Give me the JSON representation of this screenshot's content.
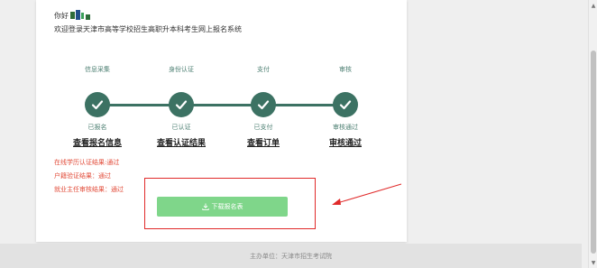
{
  "header": {
    "greeting": "你好",
    "welcome": "欢迎登录天津市高等学校招生高职升本科考生网上报名系统"
  },
  "steps": [
    {
      "label": "信息采集",
      "status": "已报名",
      "link": "查看报名信息"
    },
    {
      "label": "身份认证",
      "status": "已认证",
      "link": "查看认证结果"
    },
    {
      "label": "支付",
      "status": "已支付",
      "link": "查看订单"
    },
    {
      "label": "审核",
      "status": "审核通过",
      "link": "审核通过"
    }
  ],
  "results": [
    "在线学历认证结果:通过",
    "户籍验证结果：通过",
    "就业主任审核结果：通过"
  ],
  "download": {
    "label": "下载报名表"
  },
  "footer": {
    "text": "主办单位：天津市招生考试院"
  },
  "colors": {
    "accent": "#3c7263",
    "button": "#7fd68a",
    "alert": "#e24c3a",
    "highlight": "#e02a2a"
  }
}
